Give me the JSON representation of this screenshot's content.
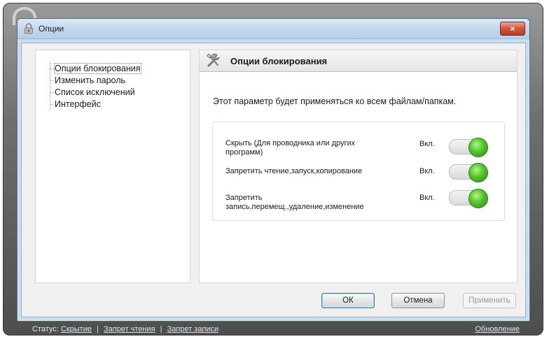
{
  "window": {
    "title": "Опции",
    "close_label": "×"
  },
  "nav": {
    "items": [
      {
        "label": "Опции блокирования",
        "selected": true
      },
      {
        "label": "Изменить пароль",
        "selected": false
      },
      {
        "label": "Список исключений",
        "selected": false
      },
      {
        "label": "Интерфейс",
        "selected": false
      }
    ]
  },
  "section": {
    "title": "Опции блокирования",
    "description": "Этот параметр будет применяться ко всем файлам/папкам.",
    "options": [
      {
        "label": "Скрыть (Для проводника или других программ)",
        "state": "Вкл.",
        "on": true
      },
      {
        "label": "Запретить чтение,запуск,копирование",
        "state": "Вкл.",
        "on": true
      },
      {
        "label": "Запретить запись,перемещ.,удаление,изменение",
        "state": "Вкл.",
        "on": true
      }
    ]
  },
  "buttons": {
    "ok": "ОК",
    "cancel": "Отмена",
    "apply": "Применить"
  },
  "status": {
    "prefix": "Статус:",
    "links": [
      "Скрытие",
      "Запрет чтения",
      "Запрет записи"
    ],
    "update": "Обновление"
  },
  "colors": {
    "toggle_on": "#52c22a",
    "titlebar": "#c4d8ee",
    "close": "#d05a43"
  },
  "icons": {
    "title": "lock-icon",
    "section": "tools-icon",
    "close": "close-icon"
  }
}
